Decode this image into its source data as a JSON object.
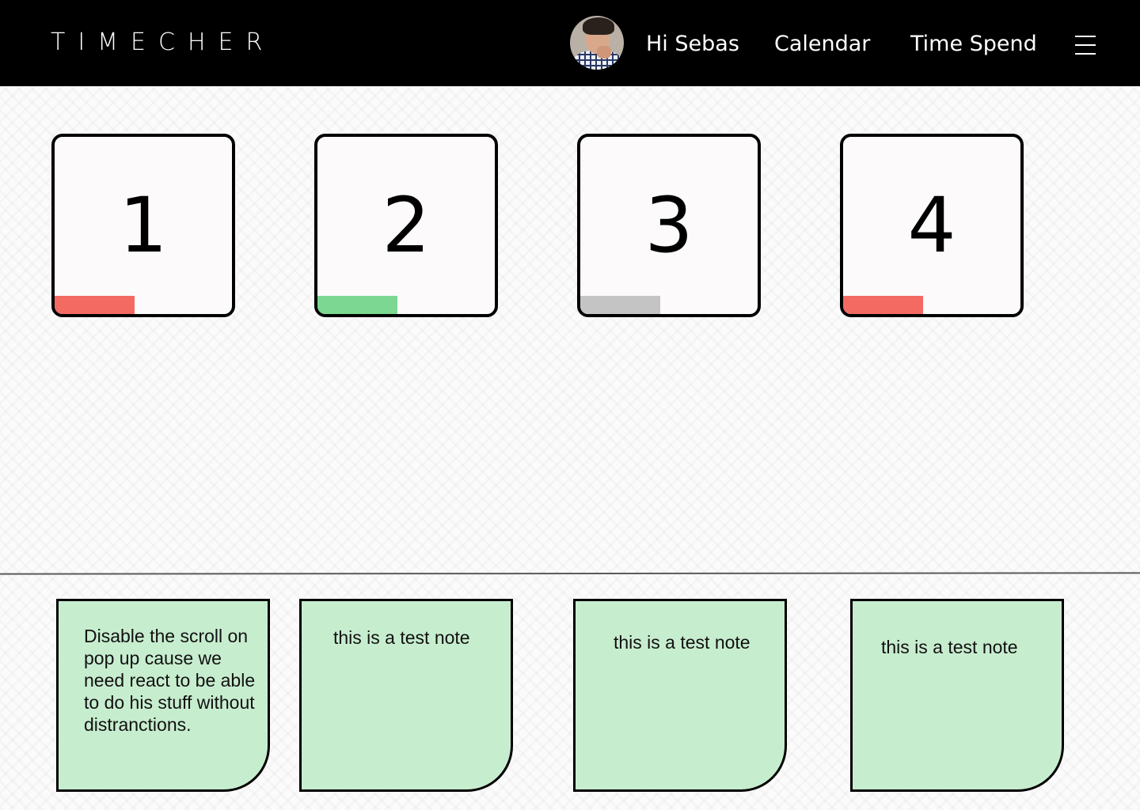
{
  "header": {
    "logo": "TIMECHER",
    "greeting": "Hi Sebas",
    "nav": [
      "Calendar",
      "Time Spend"
    ]
  },
  "days": [
    {
      "number": "1",
      "bar_color": "#f26a62",
      "bar_fill": 0.45
    },
    {
      "number": "2",
      "bar_color": "#7bd792",
      "bar_fill": 0.45
    },
    {
      "number": "3",
      "bar_color": "#c4c4c4",
      "bar_fill": 0.45
    },
    {
      "number": "4",
      "bar_color": "#f26a62",
      "bar_fill": 0.45
    }
  ],
  "notes": [
    {
      "text": "Disable the scroll on pop up cause we need react to be able to do his stuff without distranctions."
    },
    {
      "text": "this is a test note"
    },
    {
      "text": "this is a test note"
    },
    {
      "text": "this is a test note"
    }
  ],
  "colors": {
    "header_bg": "#000000",
    "note_bg": "#c7edcf",
    "card_bg": "#fcfafa"
  }
}
